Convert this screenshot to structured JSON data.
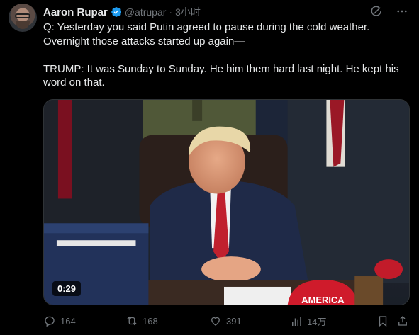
{
  "author": {
    "display_name": "Aaron Rupar",
    "handle": "@atrupar",
    "separator": "·",
    "time": "3小时"
  },
  "tweet": {
    "lines": [
      "Q: Yesterday you said Putin agreed to pause during the cold weather.",
      "Overnight those attacks started up again—",
      "",
      "TRUMP: It was Sunday to Sunday. He him them hard last night. He kept his",
      "word on that."
    ]
  },
  "media": {
    "duration": "0:29",
    "cap_text": "AMERICA"
  },
  "actions": {
    "replies": "164",
    "reposts": "168",
    "likes": "391",
    "views": "14万"
  },
  "colors": {
    "background": "#000000",
    "text": "#e7e9ea",
    "muted": "#71767b",
    "verified": "#1d9bf0"
  }
}
